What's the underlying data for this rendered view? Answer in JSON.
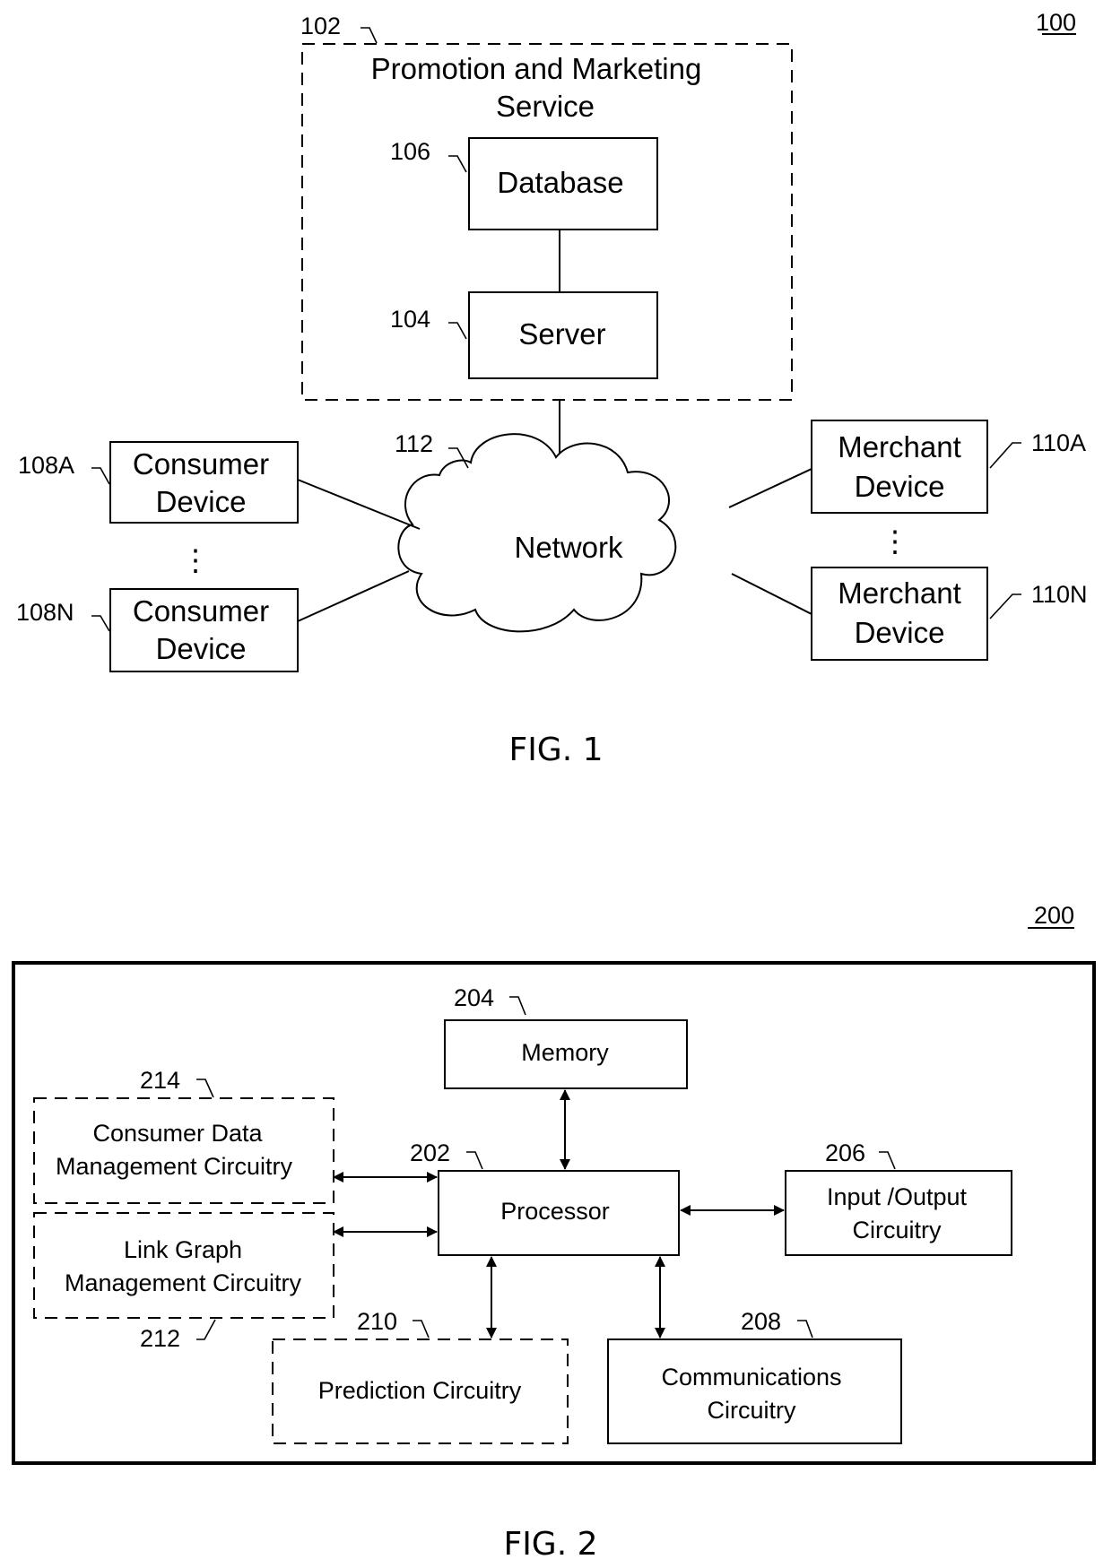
{
  "figure1": {
    "ref_numeral": "100",
    "caption": "FIG. 1",
    "service": {
      "ref": "102",
      "title_line1": "Promotion and Marketing",
      "title_line2": "Service"
    },
    "database": {
      "ref": "106",
      "label": "Database"
    },
    "server": {
      "ref": "104",
      "label": "Server"
    },
    "network": {
      "ref": "112",
      "label": "Network"
    },
    "consumer_devices": [
      {
        "ref": "108A",
        "line1": "Consumer",
        "line2": "Device"
      },
      {
        "ref": "108N",
        "line1": "Consumer",
        "line2": "Device"
      }
    ],
    "merchant_devices": [
      {
        "ref": "110A",
        "line1": "Merchant",
        "line2": "Device"
      },
      {
        "ref": "110N",
        "line1": "Merchant",
        "line2": "Device"
      }
    ],
    "ellipsis": "⋮"
  },
  "figure2": {
    "ref_numeral": "200",
    "caption": "FIG. 2",
    "memory": {
      "ref": "204",
      "label": "Memory"
    },
    "processor": {
      "ref": "202",
      "label": "Processor"
    },
    "io": {
      "ref": "206",
      "line1": "Input /Output",
      "line2": "Circuitry"
    },
    "communications": {
      "ref": "208",
      "line1": "Communications",
      "line2": "Circuitry"
    },
    "prediction": {
      "ref": "210",
      "label": "Prediction Circuitry"
    },
    "link_graph": {
      "ref": "212",
      "line1": "Link Graph",
      "line2": "Management Circuitry"
    },
    "consumer_data": {
      "ref": "214",
      "line1": "Consumer Data",
      "line2": "Management Circuitry"
    }
  }
}
